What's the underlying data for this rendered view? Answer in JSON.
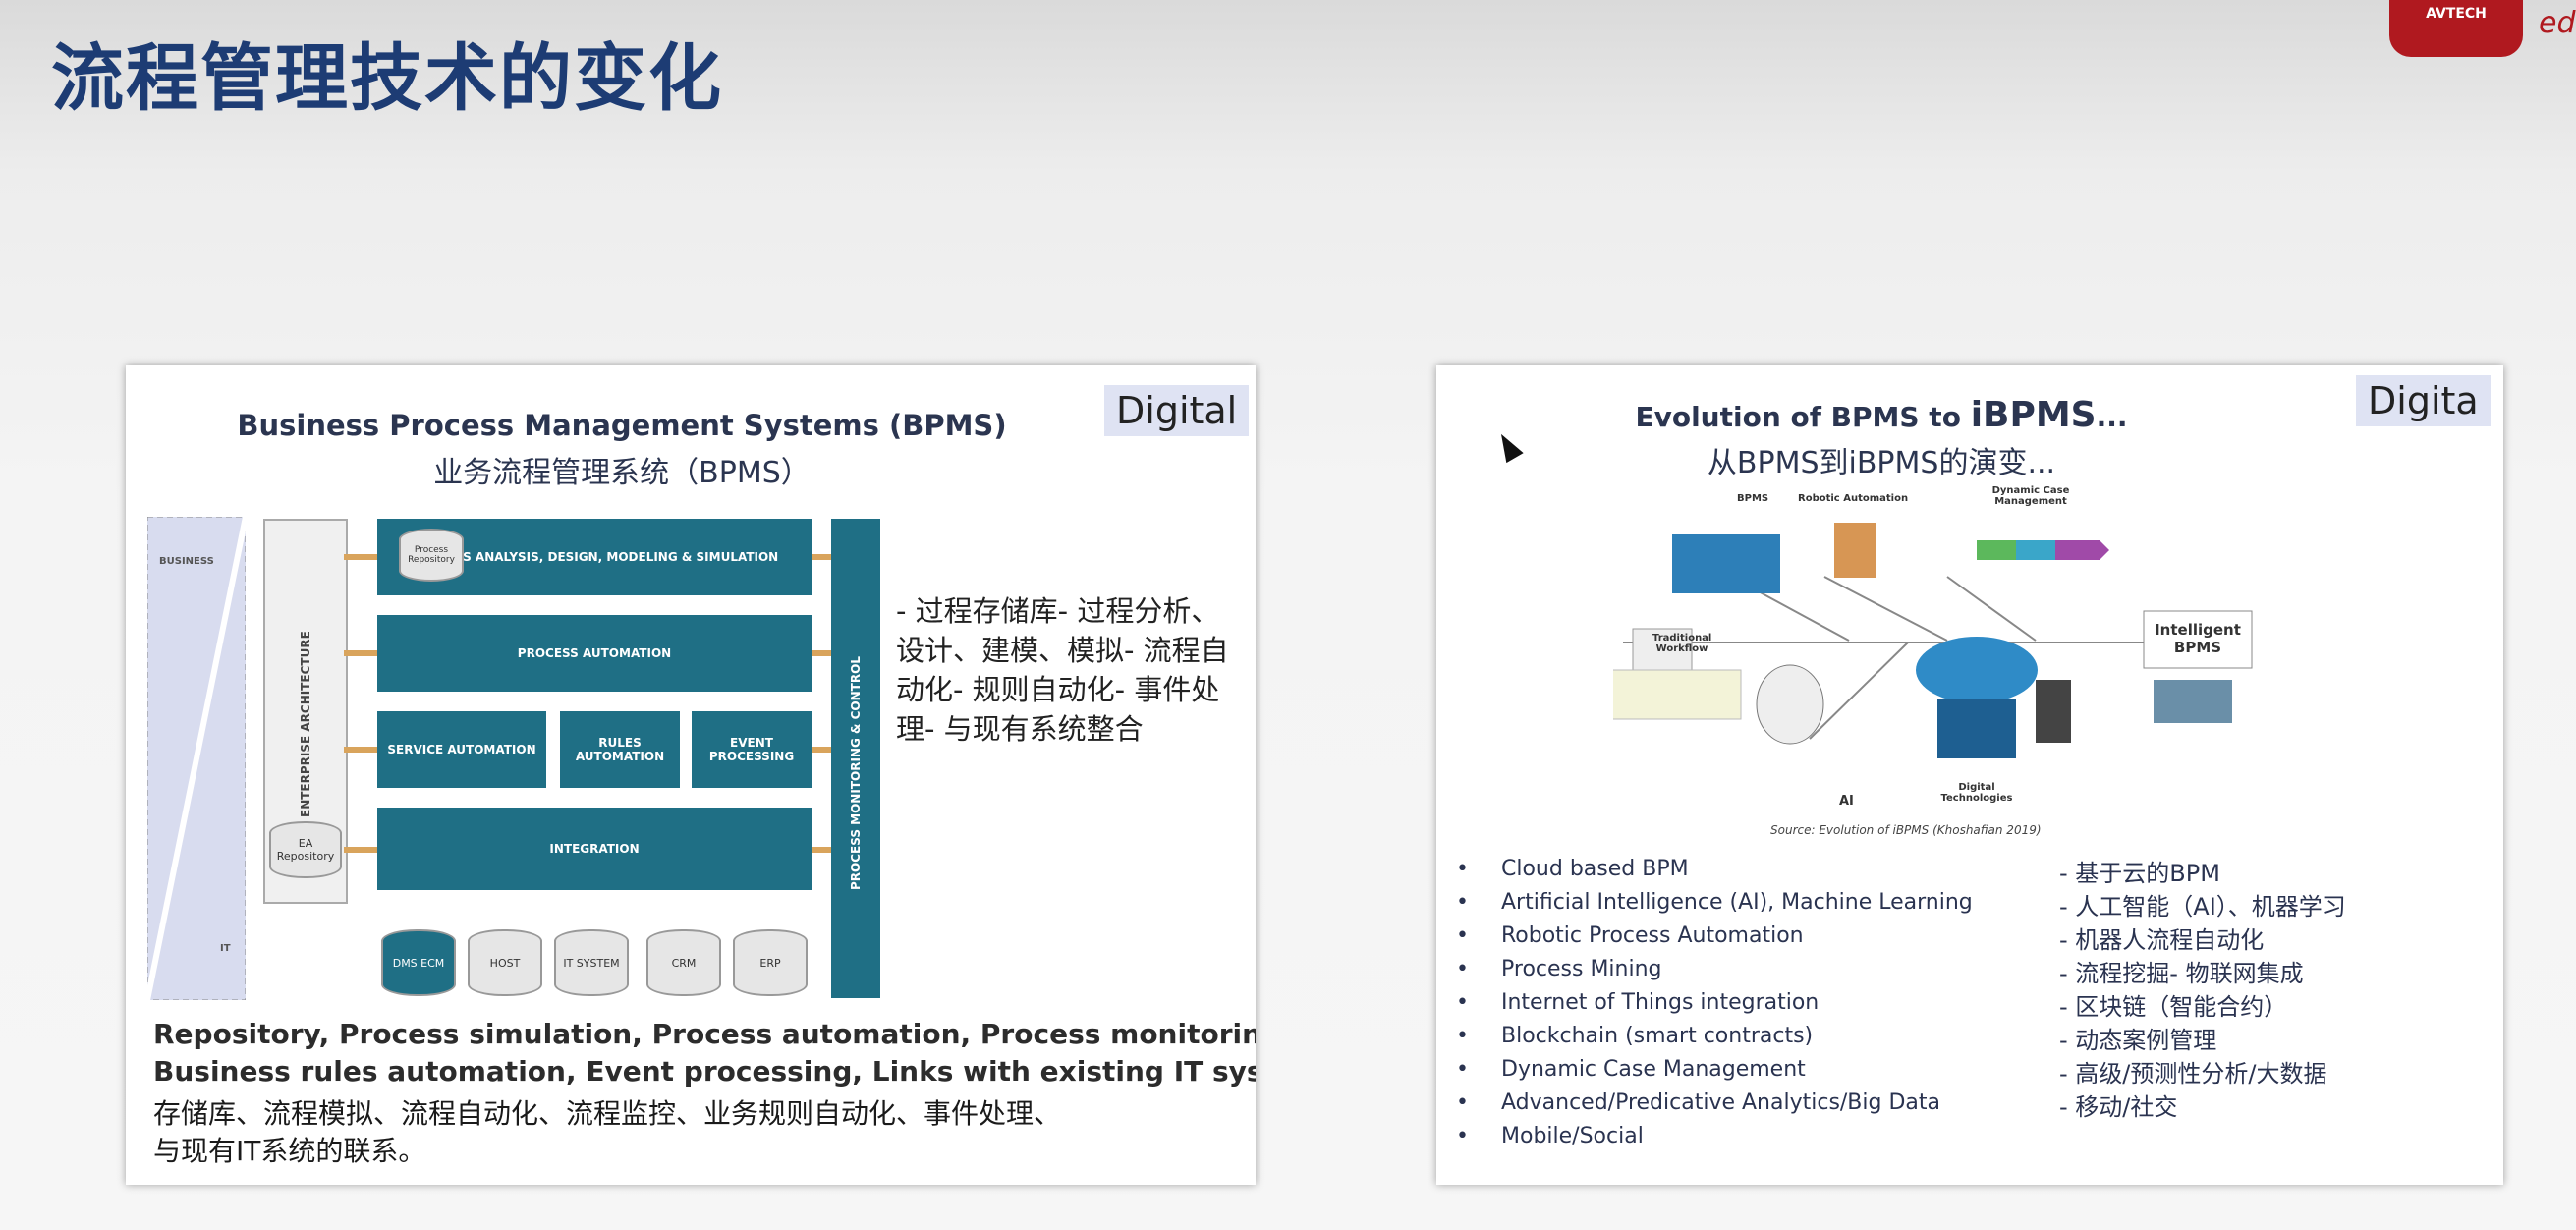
{
  "slide": {
    "title": "流程管理技术的变化",
    "logo_text": "AVTECH",
    "logo_right_text": "ed"
  },
  "left_panel": {
    "digital_tag": "Digital",
    "title_en": "Business Process Management Systems (BPMS)",
    "title_cn": "业务流程管理系统（BPMS）",
    "diagram": {
      "business_label": "BUSINESS",
      "it_label": "IT",
      "enterprise_architecture": "ENTERPRISE ARCHITECTURE",
      "ea_repository": "EA Repository",
      "process_repository": "Process Repository",
      "process_analysis": "PROCESS ANALYSIS, DESIGN, MODELING & SIMULATION",
      "process_automation": "PROCESS AUTOMATION",
      "service_automation": "SERVICE AUTOMATION",
      "rules_automation": "RULES AUTOMATION",
      "event_processing": "EVENT PROCESSING",
      "integration": "INTEGRATION",
      "monitoring": "PROCESS MONITORING & CONTROL",
      "systems": [
        "DMS ECM",
        "HOST",
        "IT SYSTEM",
        "CRM",
        "ERP"
      ]
    },
    "bullet_cn": "- 过程存储库- 过程分析、设计、建模、模拟- 流程自动化- 规则自动化- 事件处理- 与现有系统整合",
    "bottom_en_1": "Repository, Process simulation, Process automation, Process monitoring,",
    "bottom_en_2": "Business rules automation, Event processing, Links with existing IT systems, ...",
    "bottom_cn_1": " 存储库、流程模拟、流程自动化、流程监控、业务规则自动化、事件处理、",
    "bottom_cn_2": "与现有IT系统的联系。"
  },
  "right_panel": {
    "digital_tag": "Digita",
    "title_en_prefix": "Evolution of BPMS to ",
    "title_en_strong": "iBPMS",
    "title_en_suffix": "...",
    "title_cn": "从BPMS到iBPMS的演变...",
    "diagram": {
      "bpms": "BPMS",
      "robotic_automation": "Robotic Automation",
      "dynamic_case": "Dynamic Case Management",
      "traditional_workflow": "Traditional Workflow",
      "intelligent_bpms": "Intelligent BPMS",
      "ai": "AI",
      "digital_technologies": "Digital Technologies"
    },
    "source": "Source:  Evolution of iBPMS (Khoshafian 2019)",
    "bullets_en": [
      "Cloud based BPM",
      "Artificial Intelligence (AI), Machine Learning",
      "Robotic Process Automation",
      "Process Mining",
      "Internet of Things integration",
      "Blockchain (smart contracts)",
      "Dynamic Case Management",
      "Advanced/Predicative Analytics/Big Data",
      "Mobile/Social"
    ],
    "bullet_marker": "•",
    "bullets_cn": [
      "- 基于云的BPM",
      "- 人工智能（AI）、机器学习",
      "- 机器人流程自动化",
      "- 流程挖掘- 物联网集成",
      "- 区块链（智能合约）",
      "- 动态案例管理",
      "- 高级/预测性分析/大数据",
      "- 移动/社交"
    ]
  }
}
